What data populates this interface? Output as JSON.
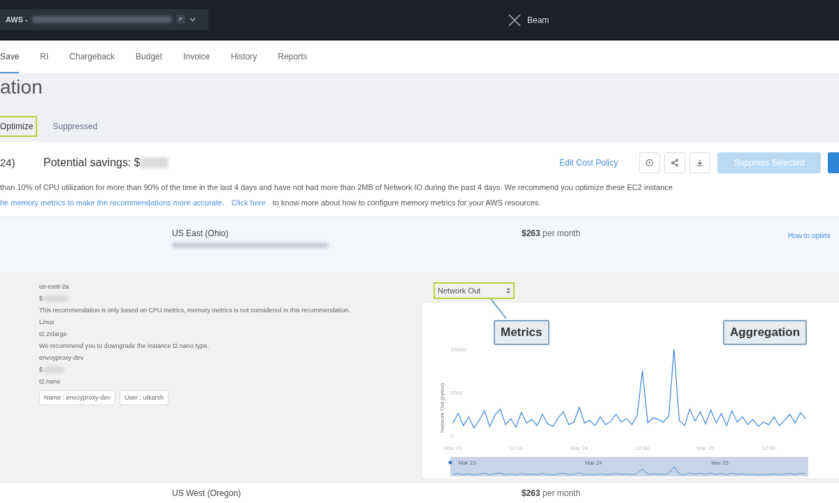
{
  "top_bar": {
    "account_prefix": "AWS -",
    "account_badge": "P",
    "brand": "Beam"
  },
  "nav_tabs": [
    {
      "label": "Save",
      "selected": true
    },
    {
      "label": "RI",
      "selected": false
    },
    {
      "label": "Chargeback",
      "selected": false
    },
    {
      "label": "Budget",
      "selected": false
    },
    {
      "label": "Invoice",
      "selected": false
    },
    {
      "label": "History",
      "selected": false
    },
    {
      "label": "Reports",
      "selected": false
    }
  ],
  "page_title": "ation",
  "sub_tabs": [
    {
      "label": "Optimize",
      "selected": true,
      "highlighted": true
    },
    {
      "label": "Suppressed",
      "selected": false,
      "highlighted": false
    }
  ],
  "summary": {
    "count": "24)",
    "savings_label": "Potential savings: $",
    "edit_link": "Edit Cost Policy",
    "suppress_button": "Suppress Selected",
    "suppress_disabled": true
  },
  "description": {
    "line_1": "than 10% of CPU utilization for more than 90% of the time in the last 4 days and have not had more than 2MB of Network IO during the past 4 days. We recommend you optimize these EC2 instance",
    "line_2_link": "he memory metrics to make the recommendations more accurate.",
    "click_link": "Click here",
    "line_2_tail": "to know more about how to configure memory metrics for your AWS resources."
  },
  "regions": [
    {
      "name": "US East (Ohio)",
      "cost": "$263",
      "period": "per month",
      "link": "How to optimi",
      "expanded": true,
      "details": {
        "zone": "us-east-2a",
        "price_prefix": "$",
        "note": "This recommendation is only based on CPU metrics, memory metrics is not considered in this recommendation.",
        "os": "Linux",
        "current_type": "t2.2xlarge",
        "advice": "We recommend you to downgrade the instance t2.nano type.",
        "instance_name": "envoyproxy-dev",
        "new_price_prefix": "$",
        "new_type": "t2.nano",
        "tags": [
          "Name : envoyproxy-dev",
          "User : utkarsh"
        ]
      }
    },
    {
      "name": "US West (Oregon)",
      "cost": "$263",
      "period": "per month",
      "expanded": false
    }
  ],
  "metric_select": {
    "value": "Network Out",
    "highlighted": true
  },
  "callouts": [
    {
      "label": "Metrics"
    },
    {
      "label": "Aggregation"
    }
  ],
  "chart": {
    "navigator_labels": [
      "Mar 23",
      "Mar 24",
      "Mar 25"
    ],
    "chart_data": {
      "type": "line",
      "ylabel": "Network Out (bytes)",
      "ylim": [
        0,
        10000
      ],
      "yticks": [
        0,
        5000,
        10000
      ],
      "categories": [
        "Mar 23",
        null,
        null,
        null,
        null,
        null,
        null,
        null,
        null,
        null,
        null,
        null,
        "12:00",
        null,
        null,
        null,
        null,
        null,
        null,
        null,
        null,
        null,
        null,
        null,
        "Mar 24",
        null,
        null,
        null,
        null,
        null,
        null,
        null,
        null,
        null,
        null,
        null,
        "12:00",
        null,
        null,
        null,
        null,
        null,
        null,
        null,
        null,
        null,
        null,
        null,
        "Mar 25",
        null,
        null,
        null,
        null,
        null,
        null,
        null,
        null,
        null,
        null,
        null,
        "12:00",
        null,
        null,
        null,
        null,
        null,
        null,
        null
      ],
      "series": [
        {
          "color": "#3b86d4",
          "values": [
            1500,
            2600,
            1200,
            2200,
            900,
            1800,
            2900,
            1100,
            2400,
            3100,
            1300,
            2000,
            1000,
            2700,
            1500,
            1900,
            1200,
            2500,
            1400,
            1100,
            2100,
            2800,
            1300,
            1600,
            3300,
            1500,
            1800,
            1200,
            2200,
            1300,
            1700,
            2500,
            1600,
            2000,
            1300,
            2400,
            7500,
            1500,
            2100,
            1900,
            1600,
            2300,
            10000,
            1800,
            1200,
            3100,
            1700,
            2800,
            1400,
            3000,
            1500,
            2600,
            1200,
            2900,
            1600,
            2200,
            1300,
            1900,
            1100,
            1600,
            1300,
            2200,
            1200,
            1800,
            2500,
            1500,
            2700,
            2000
          ]
        }
      ]
    }
  }
}
